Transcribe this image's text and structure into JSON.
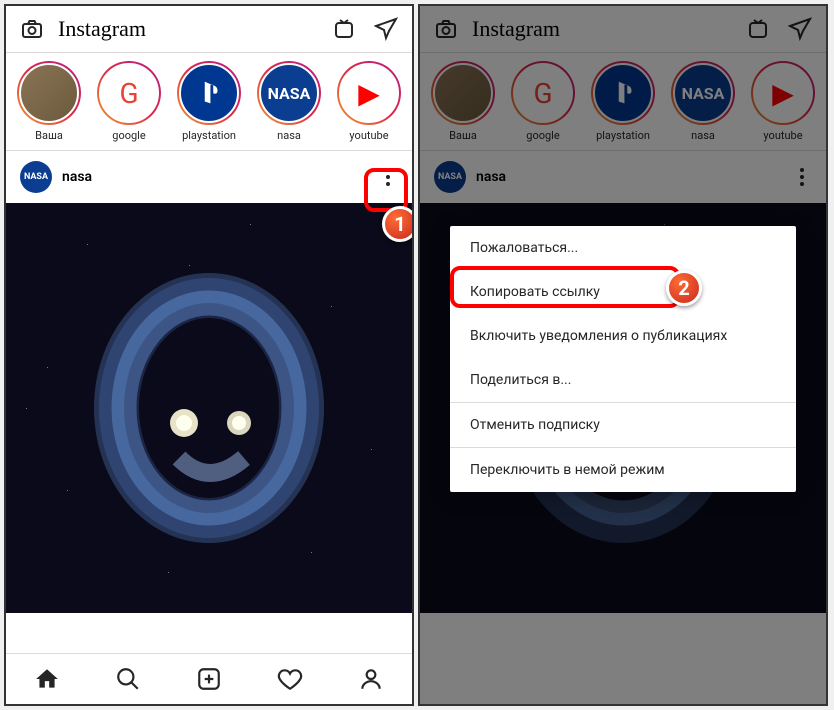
{
  "app_name": "Instagram",
  "stories": [
    {
      "label": "Ваша",
      "avatar_class": "avatar-vasha",
      "glyph": ""
    },
    {
      "label": "google",
      "avatar_class": "avatar-google",
      "glyph": "G"
    },
    {
      "label": "playstation",
      "avatar_class": "avatar-ps",
      "glyph": ""
    },
    {
      "label": "nasa",
      "avatar_class": "avatar-nasa",
      "glyph": "NASA"
    },
    {
      "label": "youtube",
      "avatar_class": "avatar-yt",
      "glyph": "▶"
    }
  ],
  "post": {
    "username": "nasa",
    "avatar_text": "NASA"
  },
  "menu_items": [
    {
      "label": "Пожаловаться...",
      "divider_after": false
    },
    {
      "label": "Копировать ссылку",
      "divider_after": false,
      "highlighted": true
    },
    {
      "label": "Включить уведомления о публикациях",
      "divider_after": false
    },
    {
      "label": "Поделиться в...",
      "divider_after": true
    },
    {
      "label": "Отменить подписку",
      "divider_after": true
    },
    {
      "label": "Переключить в немой режим",
      "divider_after": false
    }
  ],
  "annotations": {
    "badge1": "1",
    "badge2": "2"
  }
}
